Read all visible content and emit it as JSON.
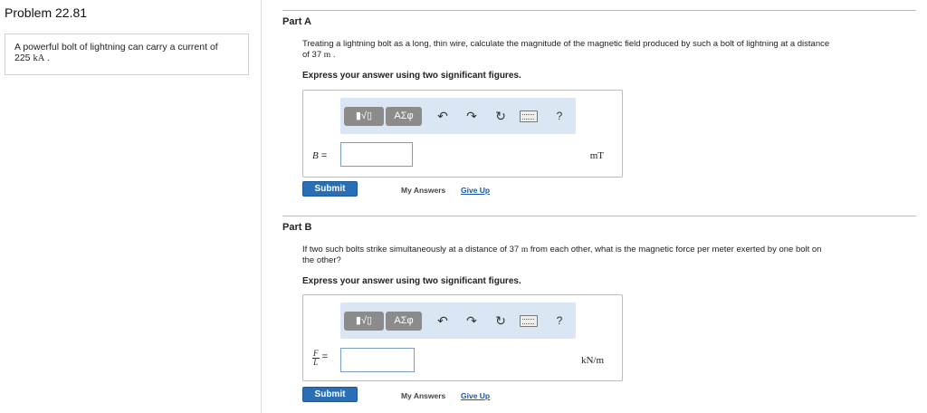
{
  "problem": {
    "title": "Problem 22.81",
    "statement": "A powerful bolt of lightning can carry a current of",
    "current_value": "225",
    "current_unit": "kA",
    "period": "."
  },
  "partA": {
    "title": "Part A",
    "question_line1": "Treating a lightning bolt as a long, thin wire, calculate the magnitude of the magnetic field produced by such a bolt of lightning at a distance",
    "question_line2_prefix": "of 37",
    "question_line2_unit": "m",
    "question_line2_suffix": ".",
    "instruction": "Express your answer using two significant figures.",
    "variable": "B",
    "equals": "=",
    "input_value": "",
    "unit": "mT",
    "submit_label": "Submit",
    "my_answers": "My Answers",
    "give_up": "Give Up"
  },
  "partB": {
    "title": "Part B",
    "question_line1_prefix": "If two such bolts strike simultaneously at a distance of 37",
    "question_line1_unit": "m",
    "question_line1_suffix": "from each other, what is the magnetic force per meter exerted by one bolt on",
    "question_line2": "the other?",
    "instruction": "Express your answer using two significant figures.",
    "var_num": "F",
    "var_den": "L",
    "equals": "=",
    "input_value": "",
    "unit": "kN/m",
    "submit_label": "Submit",
    "my_answers": "My Answers",
    "give_up": "Give Up"
  },
  "toolbar": {
    "template_label": "▮√▯",
    "symbols_label": "ΑΣφ",
    "help": "?",
    "icons": [
      "template-icon",
      "greek-symbols-icon",
      "undo-icon",
      "redo-icon",
      "reset-icon",
      "keyboard-icon",
      "help-icon"
    ]
  },
  "colors": {
    "submit_bg": "#2a6fb6",
    "toolbar_bg": "#dbe6f4",
    "link": "#1a56a5"
  }
}
